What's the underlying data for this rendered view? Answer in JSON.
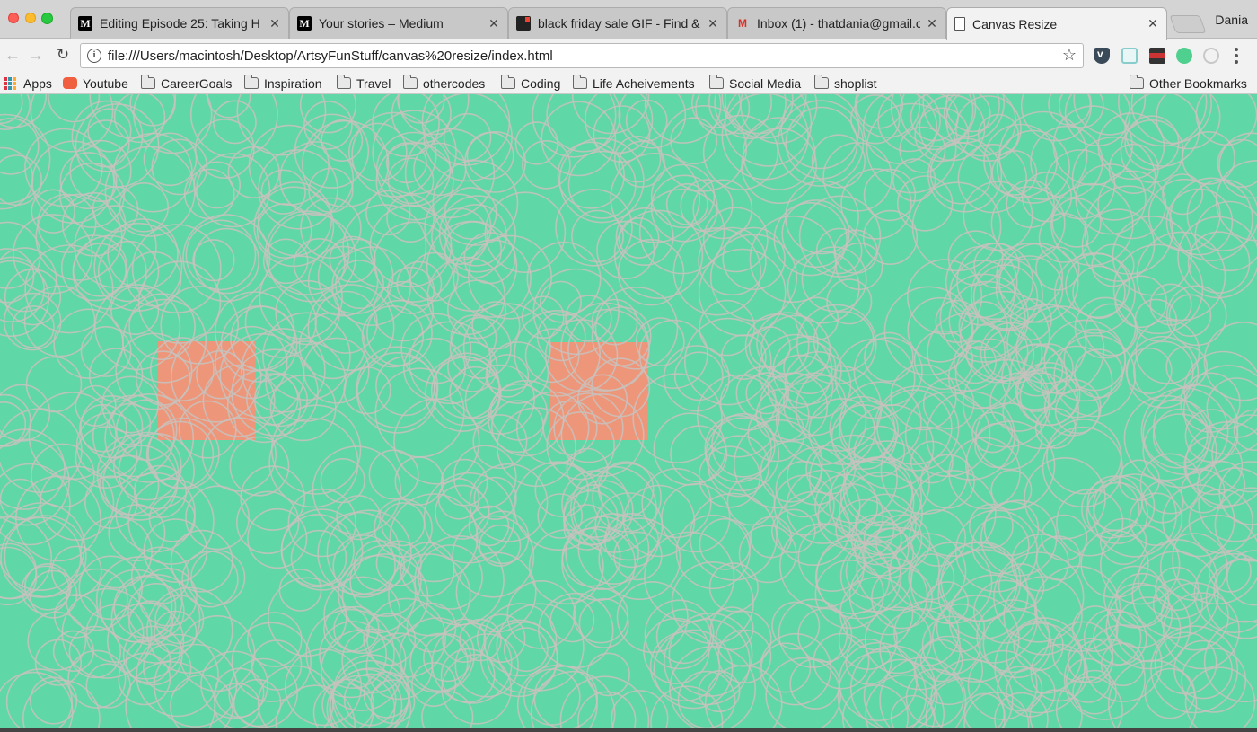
{
  "window": {
    "profile_name": "Dania"
  },
  "tabs": [
    {
      "title": "Editing Episode 25: Taking H",
      "icon": "medium-icon",
      "active": false
    },
    {
      "title": "Your stories – Medium",
      "icon": "medium-icon",
      "active": false
    },
    {
      "title": "black friday sale GIF - Find &",
      "icon": "gif-icon",
      "active": false
    },
    {
      "title": "Inbox (1) - thatdania@gmail.c",
      "icon": "gmail-icon",
      "active": false
    },
    {
      "title": "Canvas Resize",
      "icon": "page-icon",
      "active": true
    }
  ],
  "toolbar": {
    "url": "file:///Users/macintosh/Desktop/ArtsyFunStuff/canvas%20resize/index.html",
    "back_icon": "back-arrow-icon",
    "forward_icon": "forward-arrow-icon",
    "reload_icon": "reload-icon",
    "extensions": [
      "pocket-icon",
      "tray-icon",
      "flag-icon",
      "green-dot-icon",
      "ring-icon"
    ]
  },
  "bookmarks": {
    "items": [
      {
        "label": "Apps",
        "icon": "apps-icon"
      },
      {
        "label": "Youtube",
        "icon": "youtube-icon"
      },
      {
        "label": "CareerGoals",
        "icon": "folder-icon"
      },
      {
        "label": "Inspiration",
        "icon": "folder-icon"
      },
      {
        "label": "Travel",
        "icon": "folder-icon"
      },
      {
        "label": "othercodes",
        "icon": "folder-icon"
      },
      {
        "label": "Coding",
        "icon": "folder-icon"
      },
      {
        "label": "Life Acheivements",
        "icon": "folder-icon"
      },
      {
        "label": "Social Media",
        "icon": "folder-icon"
      },
      {
        "label": "shoplist",
        "icon": "folder-icon"
      }
    ],
    "other_label": "Other Bookmarks"
  },
  "canvas": {
    "background_color": "#60d7a7",
    "circle_stroke_color": "#c8c2bd",
    "square_color": "#ee967a",
    "square_count": 2,
    "circle_count": 900
  }
}
